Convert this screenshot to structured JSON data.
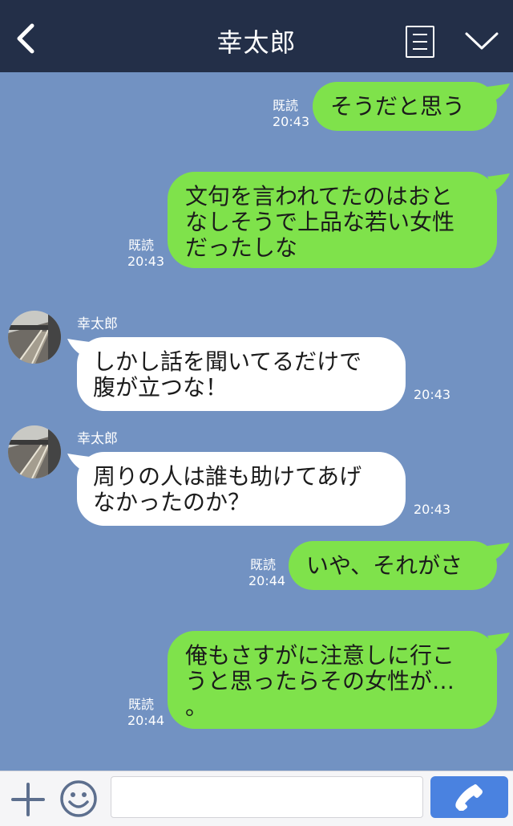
{
  "header": {
    "title": "幸太郎",
    "back_icon": "chevron-left-icon",
    "memo_icon": "note-icon",
    "menu_icon": "chevron-down-icon"
  },
  "messages": [
    {
      "side": "me",
      "text": "そうだと思う",
      "read": "既読",
      "time": "20:43"
    },
    {
      "side": "me",
      "text": "文句を言われてたのはおと\nなしそうで上品な若い女性\nだったしな",
      "read": "既読",
      "time": "20:43"
    },
    {
      "side": "them",
      "sender": "幸太郎",
      "text": "しかし話を聞いてるだけで\n腹が立つな！",
      "time": "20:43"
    },
    {
      "side": "them",
      "sender": "幸太郎",
      "text": "周りの人は誰も助けてあげ\nなかったのか？",
      "time": "20:43"
    },
    {
      "side": "me",
      "text": "いや、それがさ",
      "read": "既読",
      "time": "20:44"
    },
    {
      "side": "me",
      "text": "俺もさすがに注意しに行こ\nうと思ったらその女性が…\n。",
      "read": "既読",
      "time": "20:44"
    }
  ],
  "footer": {
    "plus_icon": "plus-icon",
    "emoji_icon": "smiley-icon",
    "input_value": "",
    "send_icon": "phone-icon"
  },
  "colors": {
    "header_bg": "#232f48",
    "chat_bg": "#7292c2",
    "my_bubble": "#7fe24b",
    "their_bubble": "#ffffff",
    "send_button": "#4a82e0"
  }
}
